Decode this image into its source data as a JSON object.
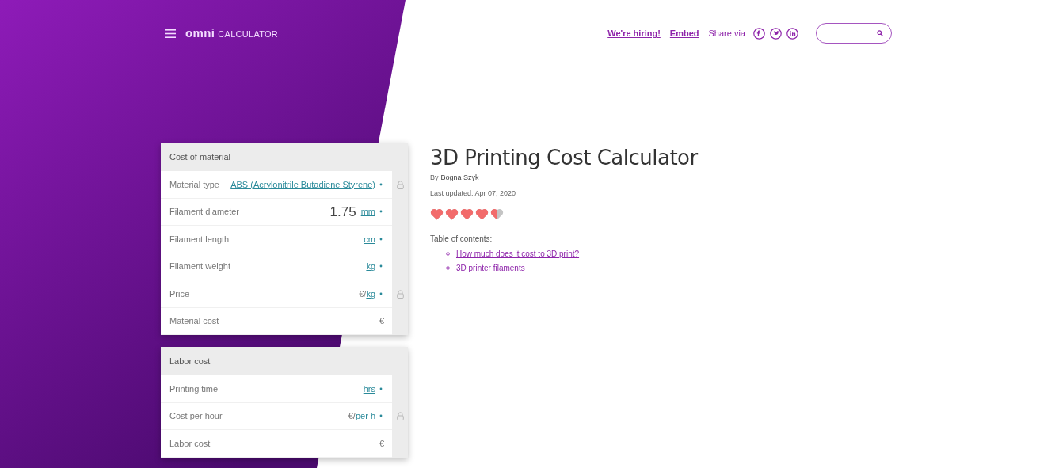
{
  "header": {
    "logo": {
      "wordmark": "omni",
      "suffix": "CALCULATOR"
    },
    "links": [
      "We're hiring!",
      "Embed"
    ],
    "share_label": "Share via",
    "share_networks": [
      {
        "kind": "facebook"
      },
      {
        "kind": "twitter"
      },
      {
        "kind": "linkedin"
      }
    ]
  },
  "sections": [
    {
      "title": "Cost of material",
      "rows": [
        {
          "label": "Material type",
          "value": "",
          "prefix": "",
          "unit": "ABS (Acrylonitrile Butadiene Styrene)",
          "locked": true
        },
        {
          "label": "Filament diameter",
          "value": "1.75",
          "prefix": "",
          "unit": "mm",
          "locked": false
        },
        {
          "label": "Filament length",
          "value": "",
          "prefix": "",
          "unit": "cm",
          "locked": false
        },
        {
          "label": "Filament weight",
          "value": "",
          "prefix": "",
          "unit": "kg",
          "locked": false
        },
        {
          "label": "Price",
          "value": "",
          "prefix": "€/",
          "unit": "kg",
          "locked": true
        },
        {
          "label": "Material cost",
          "value": "",
          "prefix": "€",
          "unit": "",
          "locked": false
        }
      ]
    },
    {
      "title": "Labor cost",
      "rows": [
        {
          "label": "Printing time",
          "value": "",
          "prefix": "",
          "unit": "hrs",
          "locked": false
        },
        {
          "label": "Cost per hour",
          "value": "",
          "prefix": "€/",
          "unit": "per h",
          "locked": true
        },
        {
          "label": "Labor cost",
          "value": "",
          "prefix": "€",
          "unit": "",
          "locked": false
        }
      ]
    }
  ],
  "article": {
    "title": "3D Printing Cost Calculator",
    "by_label": "By",
    "author": "Bogna Szyk",
    "last_updated": "Last updated: Apr 07, 2020",
    "rating": {
      "stars": 4.5
    },
    "toc_label": "Table of contents:",
    "toc": [
      "How much does it cost to 3D print?",
      "3D printer filaments"
    ]
  }
}
